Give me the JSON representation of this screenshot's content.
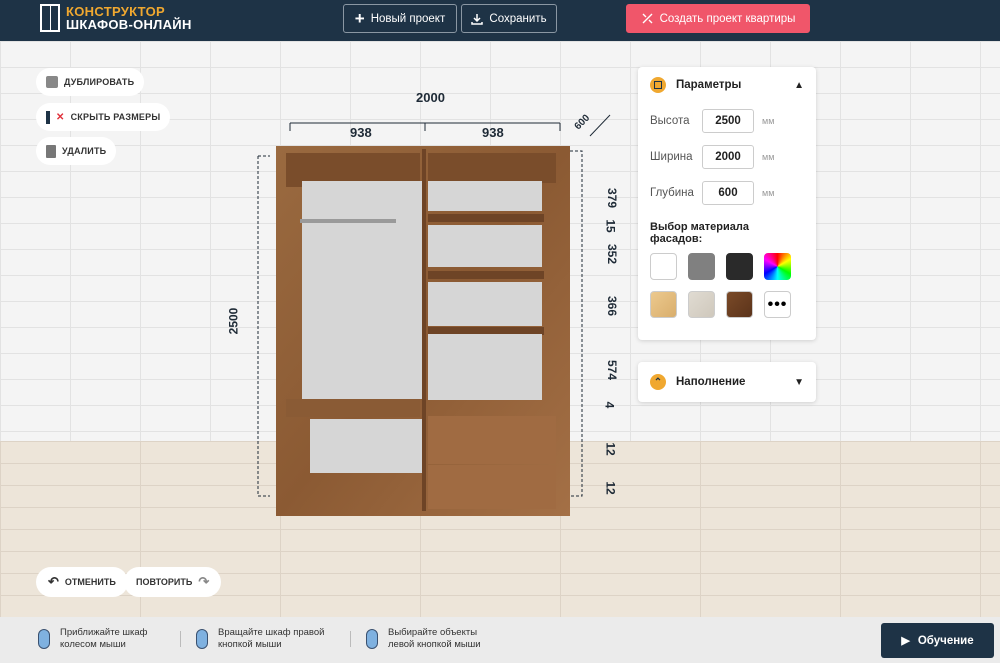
{
  "header": {
    "logo_line1": "КОНСТРУКТОР",
    "logo_line2": "ШКАФОВ-ОНЛАЙН",
    "new_project": "Новый проект",
    "save": "Сохранить",
    "create_apartment": "Создать проект квартиры"
  },
  "tools": {
    "duplicate": "ДУБЛИРОВАТЬ",
    "hide_sizes": "СКРЫТЬ РАЗМЕРЫ",
    "delete": "УДАЛИТЬ",
    "undo": "ОТМЕНИТЬ",
    "redo": "ПОВТОРИТЬ"
  },
  "dimensions": {
    "total_width": "2000",
    "left_section": "938",
    "right_section": "938",
    "depth": "600",
    "height": "2500",
    "right_side": [
      "379",
      "15",
      "352",
      "366",
      "574",
      "4",
      "12",
      "12"
    ]
  },
  "panel": {
    "title": "Параметры",
    "height_label": "Высота",
    "height_value": "2500",
    "width_label": "Ширина",
    "width_value": "2000",
    "depth_label": "Глубина",
    "depth_value": "600",
    "unit": "мм",
    "materials_title": "Выбор материала фасадов:",
    "swatch_colors": [
      "#ffffff",
      "#808080",
      "#2a2a2a",
      "rainbow",
      "#e8c48a",
      "#d8d2c8",
      "#6b3f22",
      "more"
    ],
    "filling": "Наполнение"
  },
  "footer": {
    "hint1_l1": "Приближайте шкаф",
    "hint1_l2": "колесом мыши",
    "hint2_l1": "Вращайте шкаф правой",
    "hint2_l2": "кнопкой мыши",
    "hint3_l1": "Выбирайте объекты",
    "hint3_l2": "левой кнопкой мыши",
    "learning": "Обучение"
  },
  "colors": {
    "header_bg": "#1e3346",
    "accent_orange": "#f0a830",
    "accent_pink": "#f0566a",
    "wood": "#8b5a33"
  }
}
